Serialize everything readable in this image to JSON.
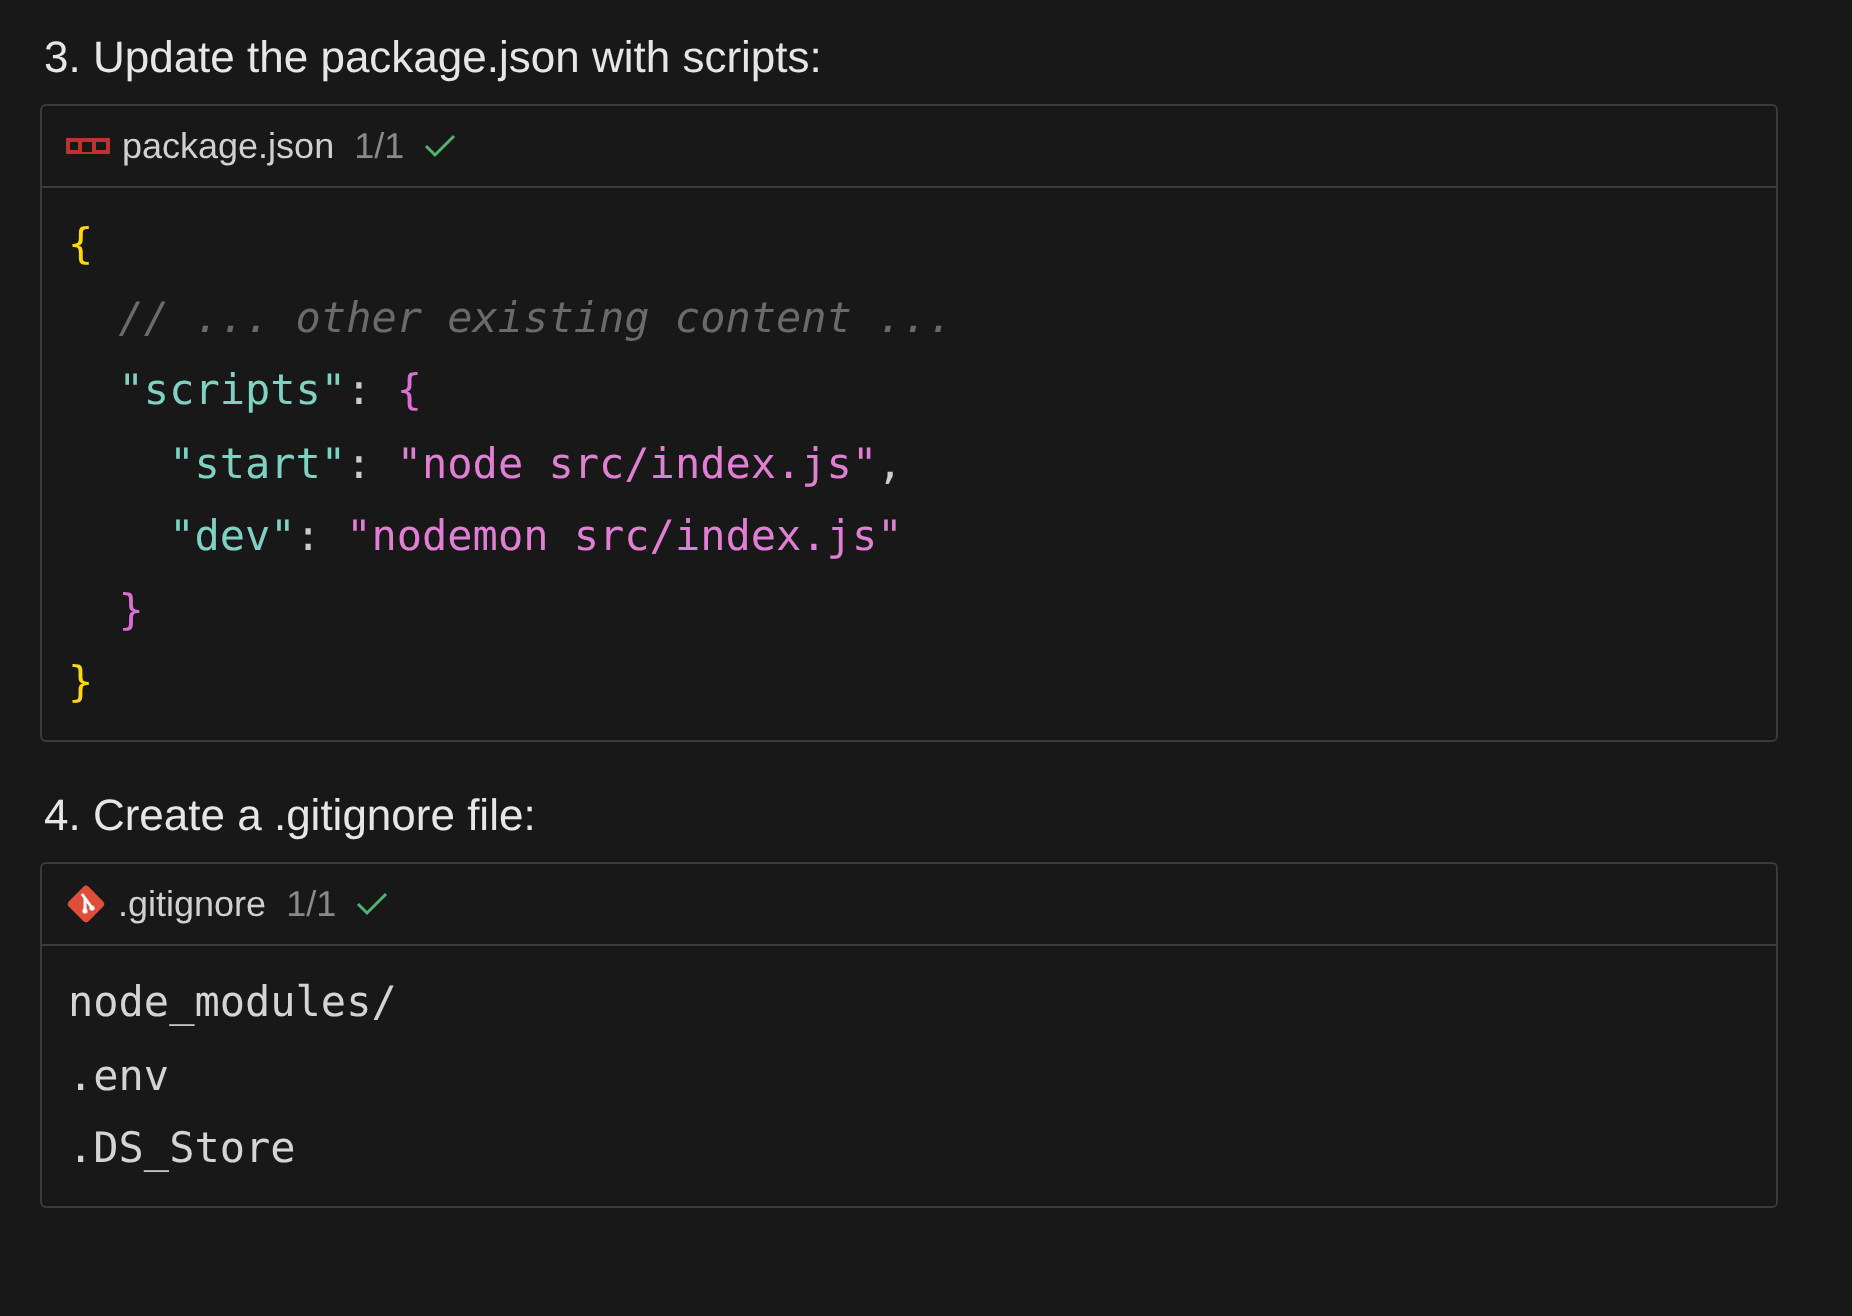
{
  "sections": [
    {
      "heading": "3. Update the package.json with scripts:",
      "file": {
        "name": "package.json",
        "kind": "npm",
        "count": "1/1",
        "applied": true
      },
      "lines": [
        [
          {
            "text": "{",
            "kind": "brace"
          }
        ],
        [
          {
            "text": "  // ... other existing content ...",
            "kind": "comment"
          }
        ],
        [
          {
            "text": "  \"scripts\"",
            "kind": "key"
          },
          {
            "text": ": ",
            "kind": "punct"
          },
          {
            "text": "{",
            "kind": "brace2"
          }
        ],
        [
          {
            "text": "    \"start\"",
            "kind": "key"
          },
          {
            "text": ": ",
            "kind": "punct"
          },
          {
            "text": "\"node src/index.js\"",
            "kind": "string"
          },
          {
            "text": ",",
            "kind": "punct"
          }
        ],
        [
          {
            "text": "    \"dev\"",
            "kind": "key"
          },
          {
            "text": ": ",
            "kind": "punct"
          },
          {
            "text": "\"nodemon src/index.js\"",
            "kind": "string"
          }
        ],
        [
          {
            "text": "  }",
            "kind": "brace2"
          }
        ],
        [
          {
            "text": "}",
            "kind": "brace"
          }
        ]
      ]
    },
    {
      "heading": "4. Create a .gitignore file:",
      "file": {
        "name": ".gitignore",
        "kind": "git",
        "count": "1/1",
        "applied": true
      },
      "lines": [
        [
          {
            "text": "node_modules/",
            "kind": "plain"
          }
        ],
        [
          {
            "text": ".env",
            "kind": "plain"
          }
        ],
        [
          {
            "text": ".DS_Store",
            "kind": "plain"
          }
        ]
      ]
    }
  ]
}
